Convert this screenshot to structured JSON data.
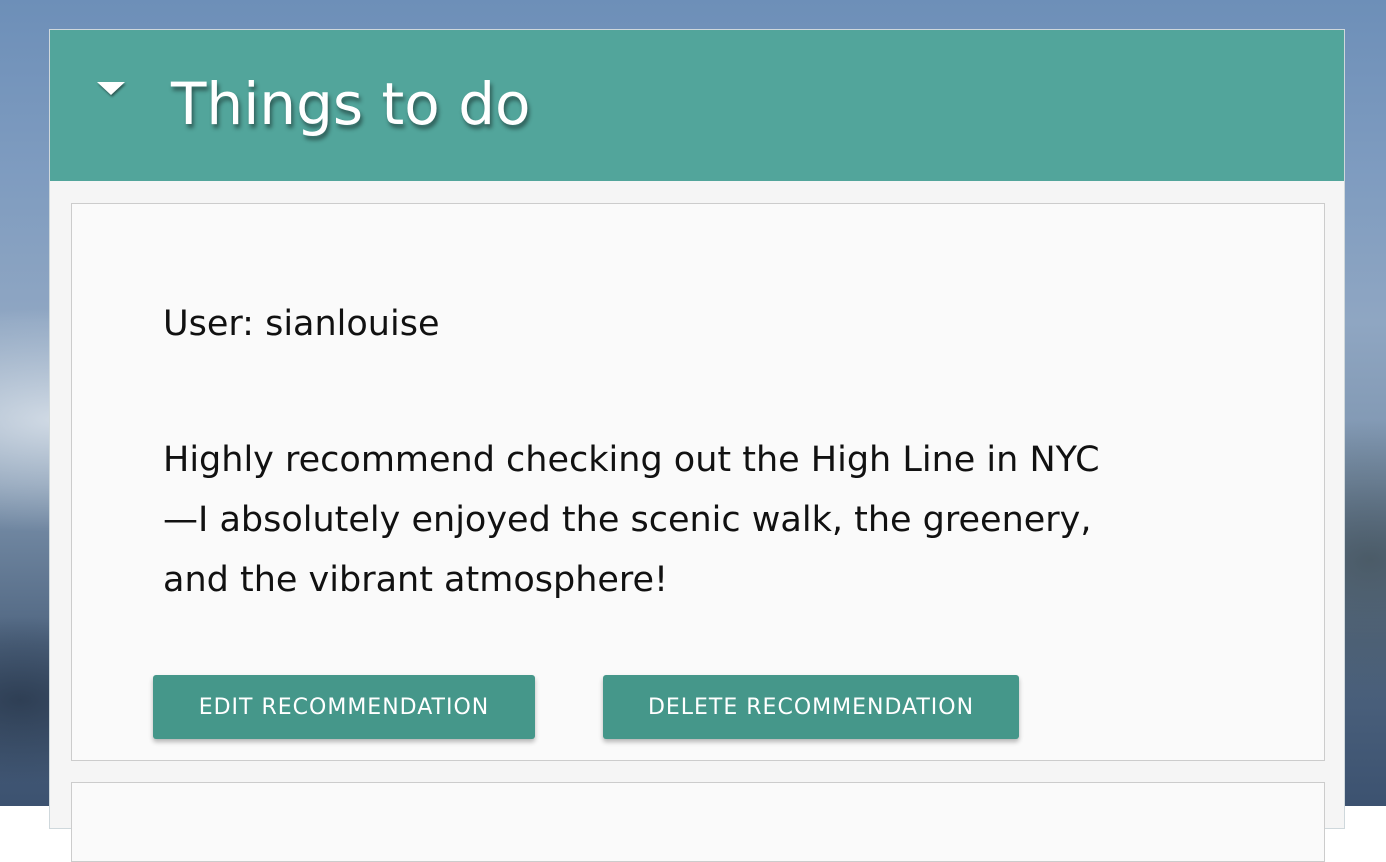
{
  "section": {
    "title": "Things to do",
    "toggle_icon": "caret-down-icon",
    "header_color": "#52a59b"
  },
  "recommendation": {
    "user_line": "User: sianlouise",
    "text_lines": [
      "Highly recommend checking out the High Line in NYC",
      "—I absolutely enjoyed the scenic walk, the greenery,",
      "and the vibrant atmosphere!"
    ],
    "edit_label": "EDIT RECOMMENDATION",
    "delete_label": "DELETE RECOMMENDATION",
    "button_color": "#45978a"
  }
}
